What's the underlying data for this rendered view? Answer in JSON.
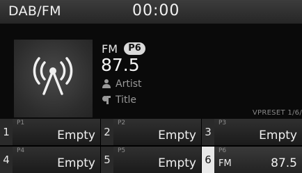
{
  "header": {
    "app_title": "DAB/FM",
    "clock": "00:00"
  },
  "now_playing": {
    "band": "FM",
    "preset_badge": "P6",
    "frequency": "87.5",
    "artist": "Artist",
    "title": "Title",
    "preset_page": "VPRESET 1/6/"
  },
  "presets": [
    {
      "number": "1",
      "slot": "P1",
      "label": "Empty"
    },
    {
      "number": "2",
      "slot": "P2",
      "label": "Empty"
    },
    {
      "number": "3",
      "slot": "P3",
      "label": "Empty"
    },
    {
      "number": "4",
      "slot": "P4",
      "label": "Empty"
    },
    {
      "number": "5",
      "slot": "P5",
      "label": "Empty"
    },
    {
      "number": "6",
      "slot": "P6",
      "band": "FM",
      "label": "87.5",
      "active": true
    }
  ],
  "icons": {
    "album_art": "radio-broadcast-icon",
    "artist": "person-icon",
    "title": "music-note-icon"
  },
  "colors": {
    "background": "#000000",
    "header": "#303030",
    "badge": "#d9d9d9",
    "active_preset_number": "#e8e8e8"
  }
}
